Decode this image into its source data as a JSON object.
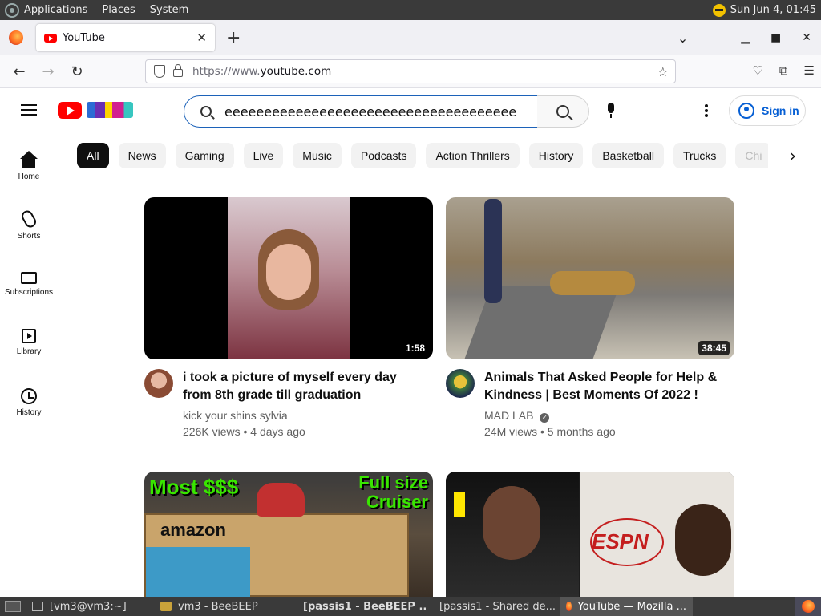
{
  "system_panel": {
    "menus": [
      "Applications",
      "Places",
      "System"
    ],
    "clock": "Sun Jun  4, 01:45"
  },
  "browser": {
    "tab_title": "YouTube",
    "url_prefix": "https://www.",
    "url_domain": "youtube.com"
  },
  "youtube": {
    "search_query": "eeeeeeeeeeeeeeeeeeeeeeeeeeeeeeeeeeeee",
    "sign_in": "Sign in",
    "sidebar": [
      {
        "label": "Home"
      },
      {
        "label": "Shorts"
      },
      {
        "label": "Subscriptions"
      },
      {
        "label": "Library"
      },
      {
        "label": "History"
      }
    ],
    "chips": [
      "All",
      "News",
      "Gaming",
      "Live",
      "Music",
      "Podcasts",
      "Action Thrillers",
      "History",
      "Basketball",
      "Trucks",
      "Chi"
    ],
    "videos": [
      {
        "title": "i took a picture of myself every day from 8th grade till graduation",
        "channel": "kick your shins sylvia",
        "stats": "226K views • 4 days ago",
        "duration": "1:58"
      },
      {
        "title": "Animals That Asked People for Help & Kindness | Best Moments Of 2022 !",
        "channel": "MAD LAB",
        "stats": "24M views • 5 months ago",
        "duration": "38:45",
        "verified": true
      },
      {
        "thumb_text_left": "Most $$$",
        "thumb_text_right": "Full size Cruiser",
        "thumb_text_box": "amazon"
      },
      {
        "thumb_text_logo": "ESPN"
      }
    ]
  },
  "taskbar": {
    "items": [
      "[vm3@vm3:~]",
      "vm3 - BeeBEEP",
      "[passis1 - BeeBEEP ...",
      "[passis1 - Shared de...",
      "YouTube — Mozilla ..."
    ]
  },
  "colors": {
    "youtube_red": "#ff0000",
    "link_blue": "#065fd4",
    "chip_active": "#0f0f0f"
  }
}
